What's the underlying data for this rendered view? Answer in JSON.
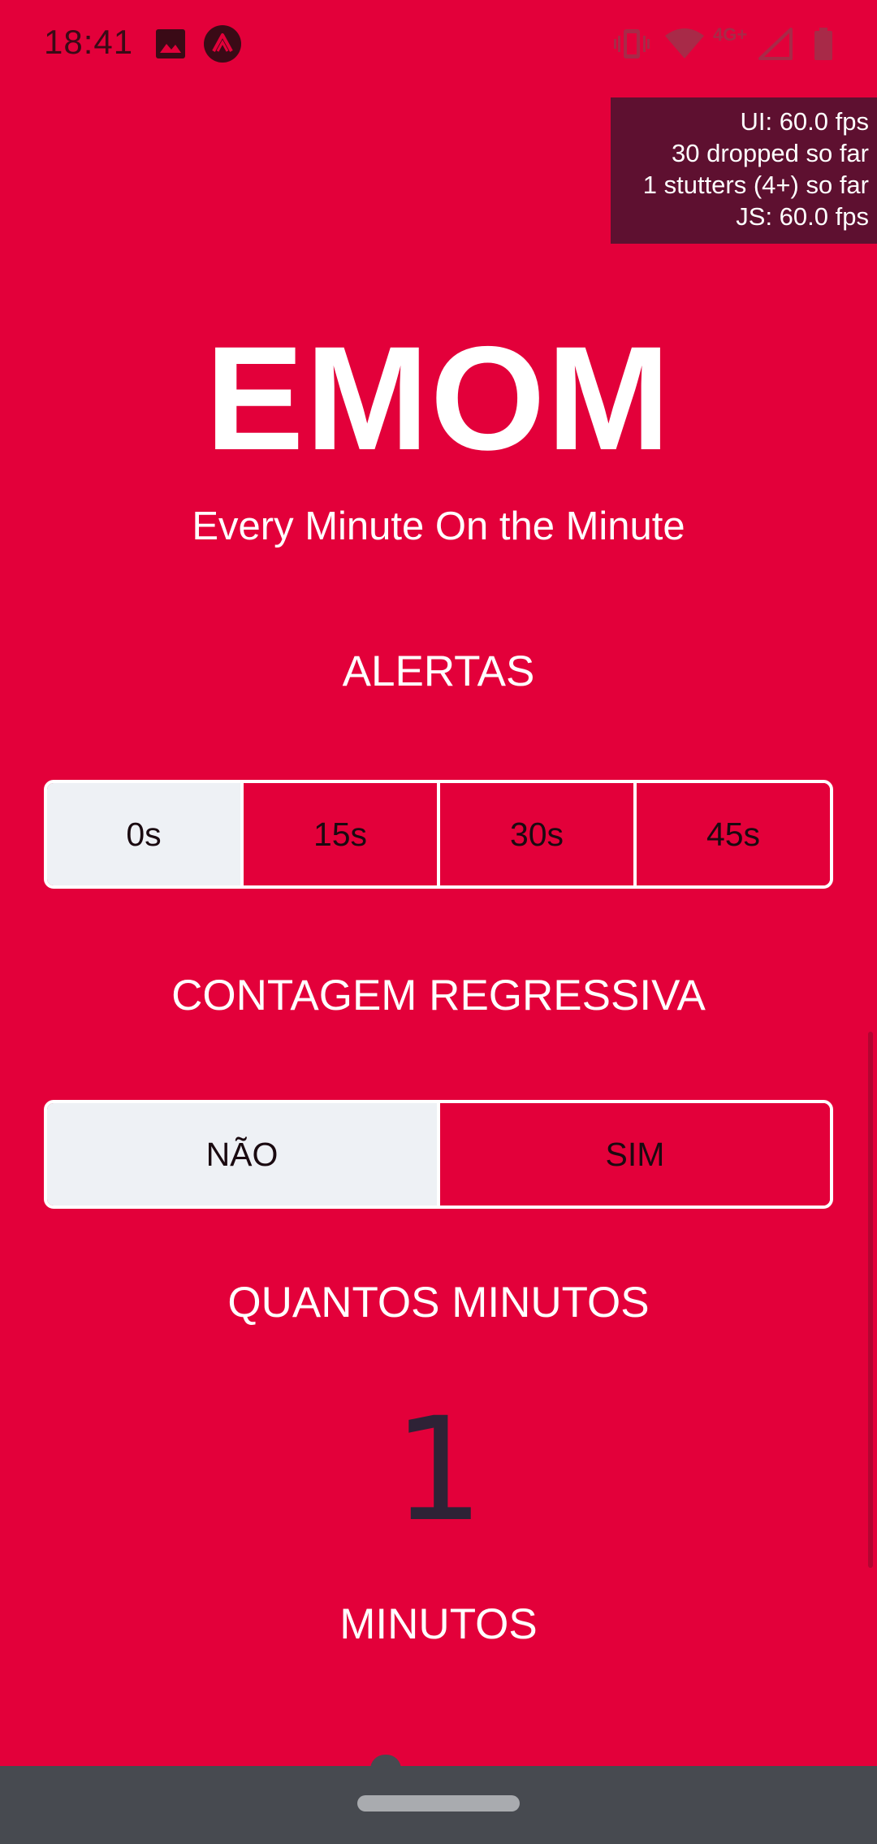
{
  "status_bar": {
    "time": "18:41",
    "network_label": "4G+",
    "icons": [
      "gallery-icon",
      "expo-icon",
      "vibrate-icon",
      "wifi-icon",
      "signal-icon",
      "battery-icon"
    ]
  },
  "perf_monitor": {
    "ui_fps": "UI: 60.0 fps",
    "dropped": "30 dropped so far",
    "stutters": "1 stutters (4+) so far",
    "js_fps": "JS: 60.0 fps"
  },
  "header": {
    "title": "EMOM",
    "subtitle": "Every Minute On the Minute"
  },
  "alerts": {
    "label": "ALERTAS",
    "options": [
      "0s",
      "15s",
      "30s",
      "45s"
    ],
    "selected": "0s"
  },
  "countdown": {
    "label": "CONTAGEM REGRESSIVA",
    "options": [
      "NÃO",
      "SIM"
    ],
    "selected": "NÃO"
  },
  "minutes": {
    "question": "QUANTOS MINUTOS",
    "value": "1",
    "unit_label": "MINUTOS"
  },
  "colors": {
    "background": "#E3003A",
    "selected_segment": "#EEF1F5",
    "perf_overlay": "#5E1030",
    "nav_bar": "#474A50",
    "number": "#2E2236"
  }
}
